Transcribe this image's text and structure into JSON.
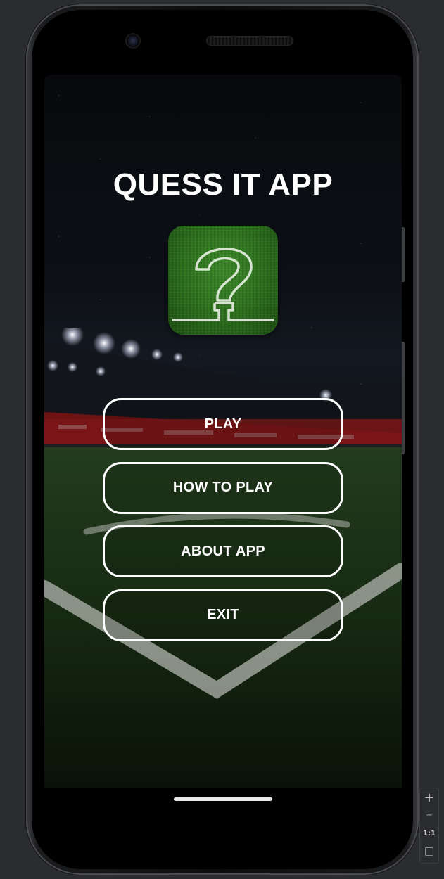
{
  "app": {
    "title": "QUESS IT APP",
    "logo_icon": "question-mark-on-grass-icon"
  },
  "menu": {
    "items": [
      {
        "label": "PLAY"
      },
      {
        "label": "HOW TO PLAY"
      },
      {
        "label": "ABOUT APP"
      },
      {
        "label": "EXIT"
      }
    ]
  },
  "emulator": {
    "zoom_in_icon": "plus-icon",
    "zoom_out_icon": "minus-icon",
    "zoom_ratio_label": "1:1",
    "fit_screen_icon": "fit-screen-icon"
  },
  "colors": {
    "text": "#ffffff",
    "button_border": "#ffffff",
    "logo_green": "#2c6f1d",
    "background": "#2b2c2f"
  }
}
